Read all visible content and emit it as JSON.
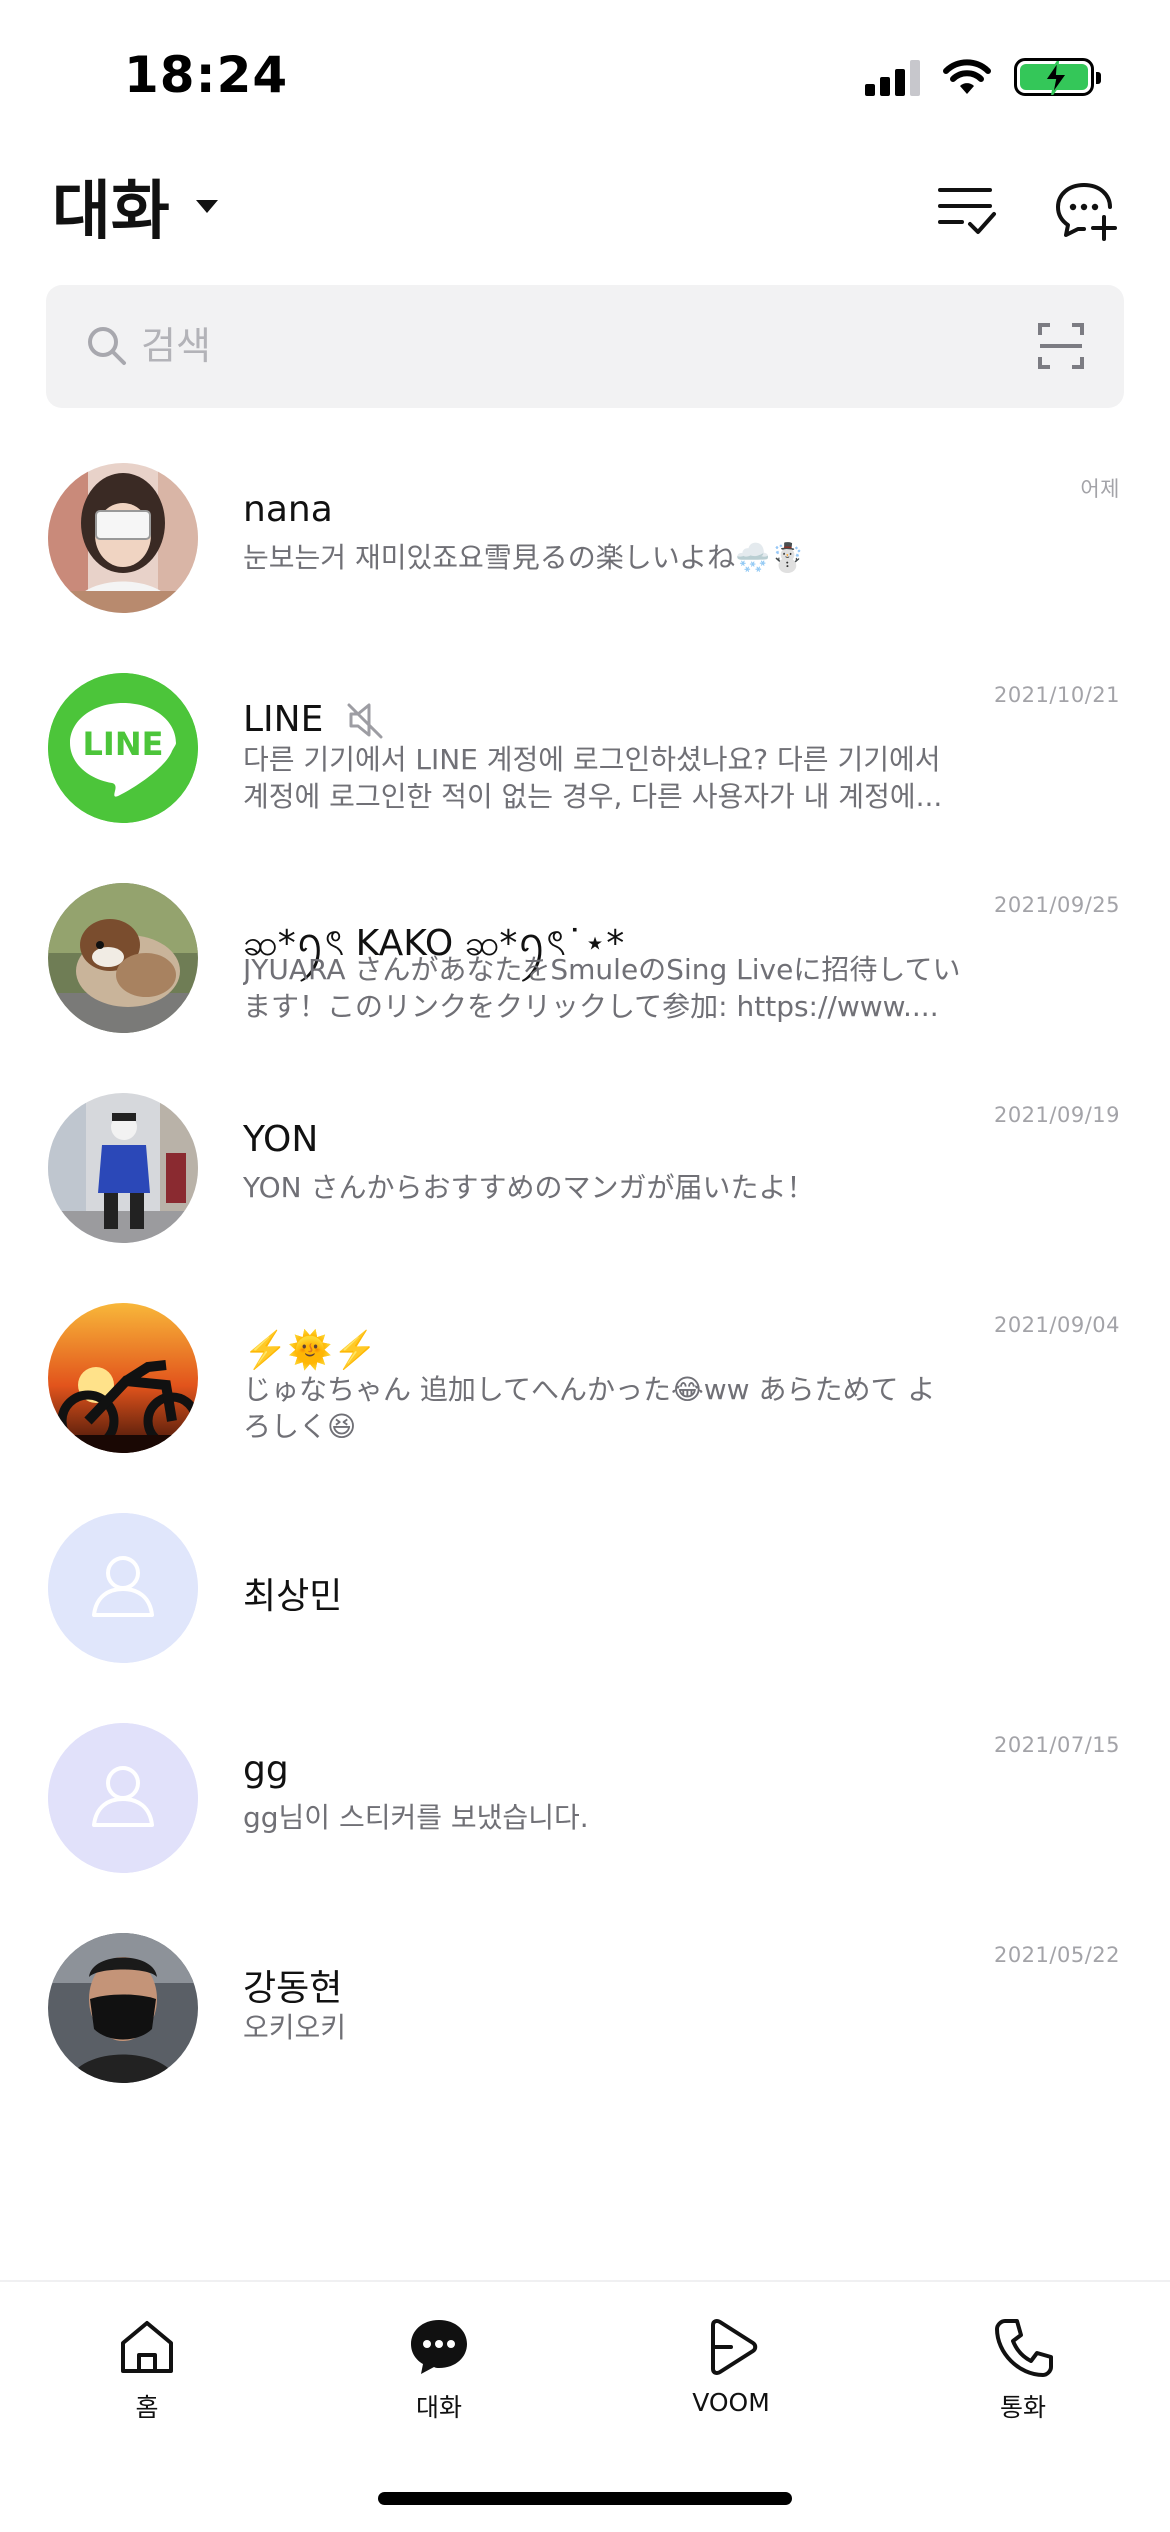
{
  "status": {
    "time": "18:24"
  },
  "header": {
    "title": "대화"
  },
  "search": {
    "placeholder": "검색"
  },
  "chats": [
    {
      "name": "nana",
      "preview": "눈보는거 재미있죠요雪見るの楽しいよね🌨️☃️",
      "date": "어제",
      "muted": false
    },
    {
      "name": "LINE",
      "preview": "다른 기기에서 LINE 계정에 로그인하셨나요? 다른 기기에서 계정에 로그인한 적이 없는 경우, 다른 사용자가 내 계정에...",
      "date": "2021/10/21",
      "muted": true,
      "logo_text": "LINE"
    },
    {
      "name": "ဆ*ꪆৎ KAKO ဆ*ꪆৎ˙⋆*",
      "preview": "JYUARA さんがあなたをSmuleのSing Liveに招待しています！このリンクをクリックして参加: https://www....",
      "date": "2021/09/25",
      "muted": false
    },
    {
      "name": "YON",
      "preview": "YON さんからおすすめのマンガが届いたよ！",
      "date": "2021/09/19",
      "muted": false
    },
    {
      "name": "⚡️🌞⚡️",
      "preview": "じゅなちゃん 追加してへんかった😂ww あらためて よろしく😆",
      "date": "2021/09/04",
      "muted": false
    },
    {
      "name": "최상민",
      "preview": "",
      "date": "",
      "muted": false
    },
    {
      "name": "gg",
      "preview": "gg님이 스티커를 보냈습니다.",
      "date": "2021/07/15",
      "muted": false
    },
    {
      "name": "강동현",
      "preview": "오키오키",
      "date": "2021/05/22",
      "muted": false
    }
  ],
  "tabs": [
    {
      "label": "홈",
      "icon": "home-icon"
    },
    {
      "label": "대화",
      "icon": "chat-bubble-icon",
      "active": true
    },
    {
      "label": "VOOM",
      "icon": "voom-play-icon"
    },
    {
      "label": "통화",
      "icon": "phone-icon"
    }
  ],
  "colors": {
    "line_green": "#4cc53a",
    "battery_green": "#34c759",
    "search_bg": "#f2f2f3",
    "default_avatar_bg": "#e0e6fb"
  }
}
